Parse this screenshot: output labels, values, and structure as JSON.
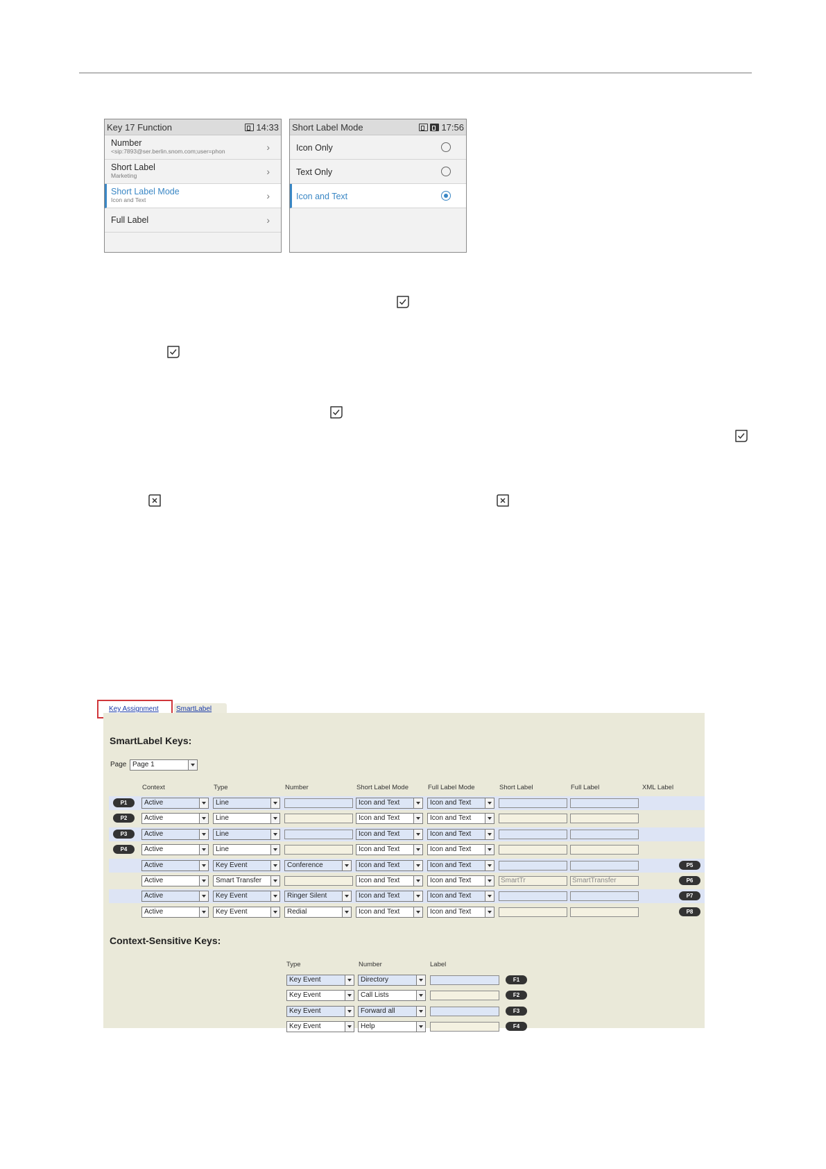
{
  "phone_left": {
    "title": "Key 17 Function",
    "time": "14:33",
    "items": [
      {
        "label": "Number",
        "sub": "<sip:7893@ser.berlin.snom.com;user=phon"
      },
      {
        "label": "Short Label",
        "sub": "Marketing"
      },
      {
        "label": "Short Label Mode",
        "sub": "Icon and Text"
      },
      {
        "label": "Full Label",
        "sub": ""
      }
    ]
  },
  "phone_right": {
    "title": "Short Label Mode",
    "time": "17:56",
    "options": [
      {
        "label": "Icon Only",
        "selected": false
      },
      {
        "label": "Text Only",
        "selected": false
      },
      {
        "label": "Icon and Text",
        "selected": true
      }
    ]
  },
  "web": {
    "tabs": [
      "Key Assignment",
      "SmartLabel"
    ],
    "smartlabel_title": "SmartLabel Keys:",
    "page_label": "Page",
    "page_value": "Page 1",
    "columns": [
      "Context",
      "Type",
      "Number",
      "Short Label Mode",
      "Full Label Mode",
      "Short Label",
      "Full Label",
      "XML Label"
    ],
    "rows": [
      {
        "left_key": "P1",
        "right_key": "",
        "context": "Active",
        "type": "Line",
        "number": "",
        "number_select": false,
        "short_mode": "Icon and Text",
        "full_mode": "Icon and Text",
        "short_label": "",
        "full_label": ""
      },
      {
        "left_key": "P2",
        "right_key": "",
        "context": "Active",
        "type": "Line",
        "number": "",
        "number_select": false,
        "short_mode": "Icon and Text",
        "full_mode": "Icon and Text",
        "short_label": "",
        "full_label": ""
      },
      {
        "left_key": "P3",
        "right_key": "",
        "context": "Active",
        "type": "Line",
        "number": "",
        "number_select": false,
        "short_mode": "Icon and Text",
        "full_mode": "Icon and Text",
        "short_label": "",
        "full_label": ""
      },
      {
        "left_key": "P4",
        "right_key": "",
        "context": "Active",
        "type": "Line",
        "number": "",
        "number_select": false,
        "short_mode": "Icon and Text",
        "full_mode": "Icon and Text",
        "short_label": "",
        "full_label": ""
      },
      {
        "left_key": "",
        "right_key": "P5",
        "context": "Active",
        "type": "Key Event",
        "number": "Conference",
        "number_select": true,
        "short_mode": "Icon and Text",
        "full_mode": "Icon and Text",
        "short_label": "",
        "full_label": ""
      },
      {
        "left_key": "",
        "right_key": "P6",
        "context": "Active",
        "type": "Smart Transfer",
        "number": "",
        "number_select": false,
        "short_mode": "Icon and Text",
        "full_mode": "Icon and Text",
        "short_label": "SmartTr",
        "full_label": "SmartTransfer"
      },
      {
        "left_key": "",
        "right_key": "P7",
        "context": "Active",
        "type": "Key Event",
        "number": "Ringer Silent",
        "number_select": true,
        "short_mode": "Icon and Text",
        "full_mode": "Icon and Text",
        "short_label": "",
        "full_label": ""
      },
      {
        "left_key": "",
        "right_key": "P8",
        "context": "Active",
        "type": "Key Event",
        "number": "Redial",
        "number_select": true,
        "short_mode": "Icon and Text",
        "full_mode": "Icon and Text",
        "short_label": "",
        "full_label": ""
      }
    ],
    "cs_title": "Context-Sensitive Keys:",
    "cs_columns": [
      "Type",
      "Number",
      "Label"
    ],
    "cs_rows": [
      {
        "type": "Key Event",
        "number": "Directory",
        "label": "",
        "key": "F1"
      },
      {
        "type": "Key Event",
        "number": "Call Lists",
        "label": "",
        "key": "F2"
      },
      {
        "type": "Key Event",
        "number": "Forward all",
        "label": "",
        "key": "F3"
      },
      {
        "type": "Key Event",
        "number": "Help",
        "label": "",
        "key": "F4"
      }
    ]
  },
  "icons": {
    "confirm": "check-softkey-icon",
    "cancel": "x-softkey-icon"
  }
}
